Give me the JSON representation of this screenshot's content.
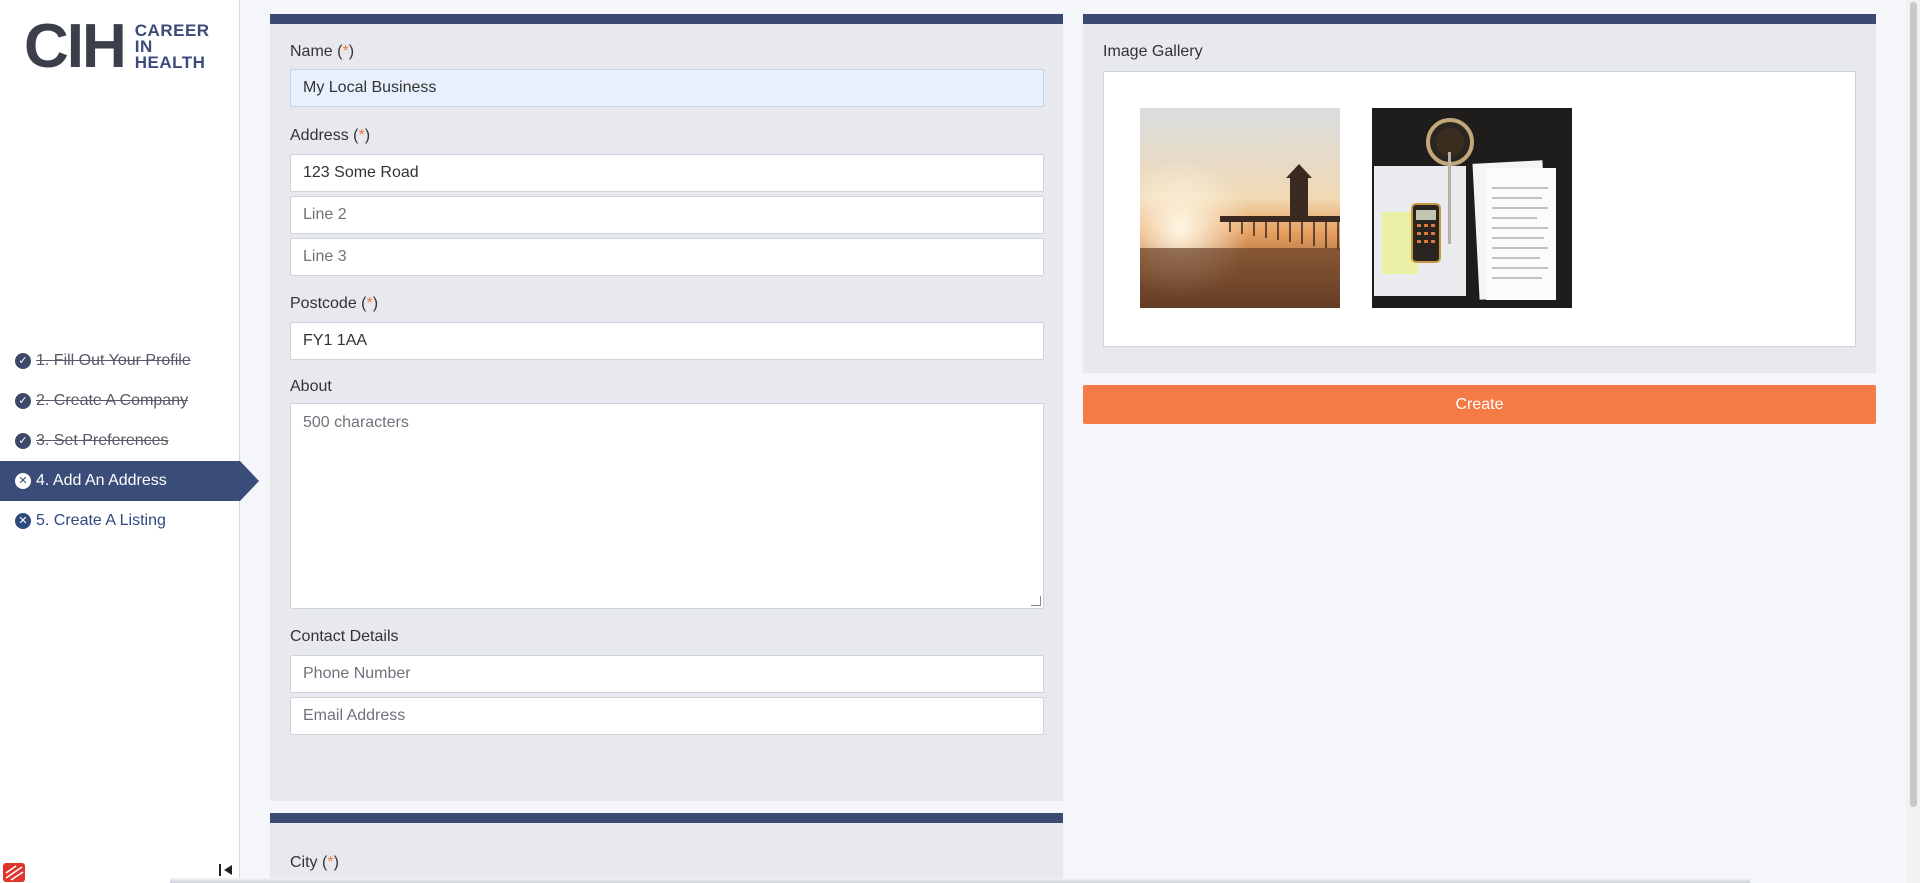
{
  "brand": {
    "mark": "CIH",
    "line1": "CAREER",
    "line2": "IN",
    "line3": "HEALTH"
  },
  "steps": [
    {
      "label": "1. Fill Out Your Profile",
      "status": "done"
    },
    {
      "label": "2. Create A Company",
      "status": "done"
    },
    {
      "label": "3. Set Preferences",
      "status": "done"
    },
    {
      "label": "4. Add An Address",
      "status": "active"
    },
    {
      "label": "5. Create A Listing",
      "status": "todo"
    }
  ],
  "form": {
    "name_label": "Name (",
    "name_value": "My Local Business",
    "address_label": "Address (",
    "address_line1": "123 Some Road",
    "address_line2_placeholder": "Line 2",
    "address_line3_placeholder": "Line 3",
    "postcode_label": "Postcode (",
    "postcode_value": "FY1 1AA",
    "about_label": "About",
    "about_placeholder": "500 characters",
    "contact_label": "Contact Details",
    "phone_placeholder": "Phone Number",
    "email_placeholder": "Email Address",
    "city_label": "City (",
    "required_mark": "*",
    "close_paren": ")"
  },
  "gallery": {
    "title": "Image Gallery",
    "images": [
      {
        "name": "pier-at-sunset"
      },
      {
        "name": "desk-with-calculator-and-documents"
      }
    ]
  },
  "actions": {
    "create_label": "Create"
  },
  "colors": {
    "navy": "#3a4a72",
    "accent_orange": "#f47b45",
    "panel_bg": "#e7e9ee",
    "active_step": "#3a4d79"
  }
}
